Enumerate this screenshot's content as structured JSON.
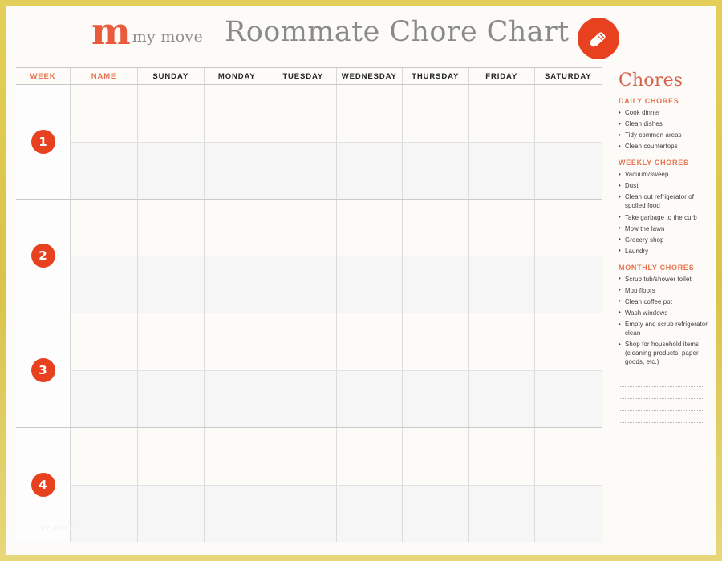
{
  "header": {
    "logo_mark": "m",
    "logo_words": "my move",
    "title": "Roommate Chore Chart",
    "badge_icon": "brush-icon"
  },
  "table": {
    "columns": [
      "WEEK",
      "NAME",
      "SUNDAY",
      "MONDAY",
      "TUESDAY",
      "WEDNESDAY",
      "THURSDAY",
      "FRIDAY",
      "SATURDAY"
    ],
    "weeks": [
      "1",
      "2",
      "3",
      "4"
    ],
    "subrows_per_week": 2,
    "cells_empty": true
  },
  "chores": {
    "title": "Chores",
    "sections": [
      {
        "heading": "DAILY CHORES",
        "items": [
          "Cook dinner",
          "Clean dishes",
          "Tidy common areas",
          "Clean countertops"
        ]
      },
      {
        "heading": "WEEKLY CHORES",
        "items": [
          "Vacuum/sweep",
          "Dust",
          "Clean out refrigerator of spoiled food",
          "Take garbage to the curb",
          "Mow the lawn",
          "Grocery shop",
          "Laundry"
        ]
      },
      {
        "heading": "MONTHLY CHORES",
        "items": [
          "Scrub tub/shower toilet",
          "Mop floors",
          "Clean coffee pot",
          "Wash windows",
          "Empty and scrub refrigerator clean",
          "Shop for household items (cleaning products, paper goods, etc.)"
        ]
      }
    ],
    "blank_lines": 4
  },
  "watermark": "my move",
  "colors": {
    "accent_red": "#e8411f",
    "accent_salmon": "#e8724f",
    "logo_orange": "#ea5b3d",
    "title_gray": "#8a8a8a",
    "frame_gold": "#d9c349",
    "paper": "#fdfbf8",
    "row_shade": "#f6f6f6",
    "grid_line": "#c9c9c9"
  }
}
